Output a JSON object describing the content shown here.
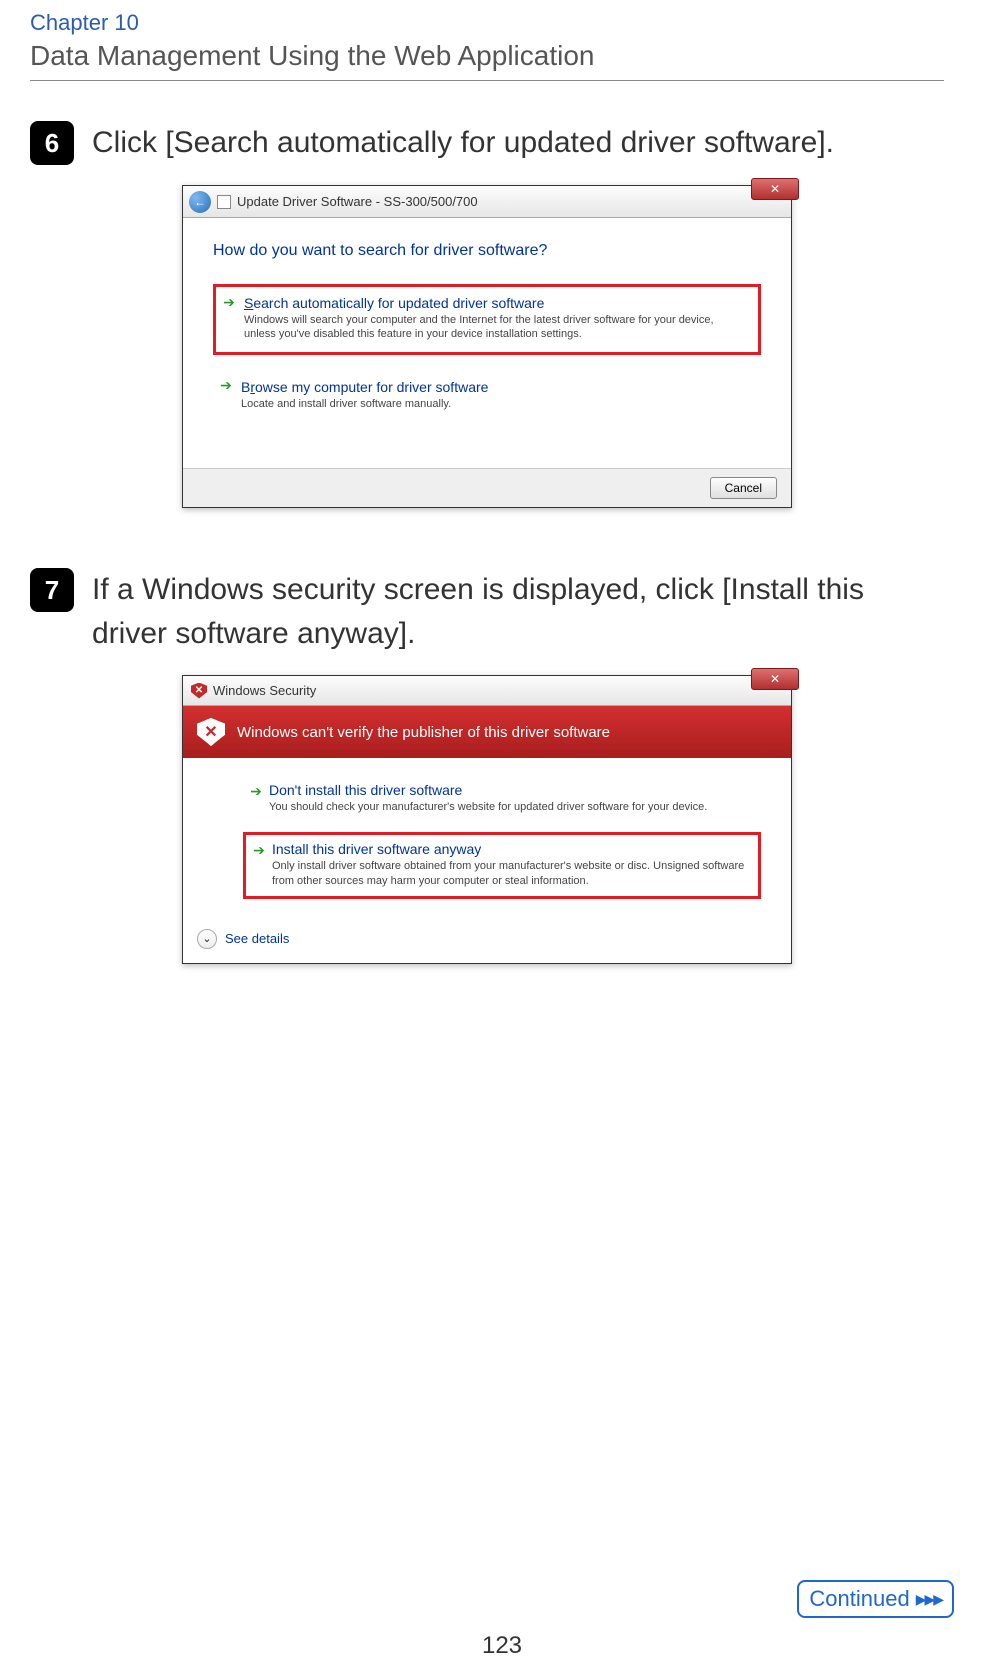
{
  "header": {
    "chapter": "Chapter 10",
    "title": "Data Management Using the Web Application"
  },
  "steps": {
    "s6": {
      "num": "6",
      "text": "Click [Search automatically for updated driver software]."
    },
    "s7": {
      "num": "7",
      "text": "If a Windows security screen is displayed, click [Install this driver software anyway]."
    }
  },
  "dialog1": {
    "back_icon": "←",
    "title": "Update Driver Software - SS-300/500/700",
    "close": "✕",
    "heading": "How do you want to search for driver software?",
    "opt1": {
      "label_pre": "S",
      "label_rest": "earch automatically for updated driver software",
      "desc": "Windows will search your computer and the Internet for the latest driver software for your device, unless you've disabled this feature in your device installation settings."
    },
    "opt2": {
      "label_pre": "B",
      "label_mid": "r",
      "label_rest": "owse my computer for driver software",
      "desc": "Locate and install driver software manually."
    },
    "cancel": "Cancel"
  },
  "dialog2": {
    "title": "Windows Security",
    "close": "✕",
    "banner": "Windows can't verify the publisher of this driver software",
    "opt1": {
      "label": "Don't install this driver software",
      "desc": "You should check your manufacturer's website for updated driver software for your device."
    },
    "opt2": {
      "label_pre": "I",
      "label_rest": "nstall this driver software anyway",
      "desc": "Only install driver software obtained from your manufacturer's website or disc. Unsigned software from other sources may harm your computer or steal information."
    },
    "details_pre": "See ",
    "details_u": "d",
    "details_rest": "etails"
  },
  "footer": {
    "continued": "Continued",
    "page": "123"
  }
}
